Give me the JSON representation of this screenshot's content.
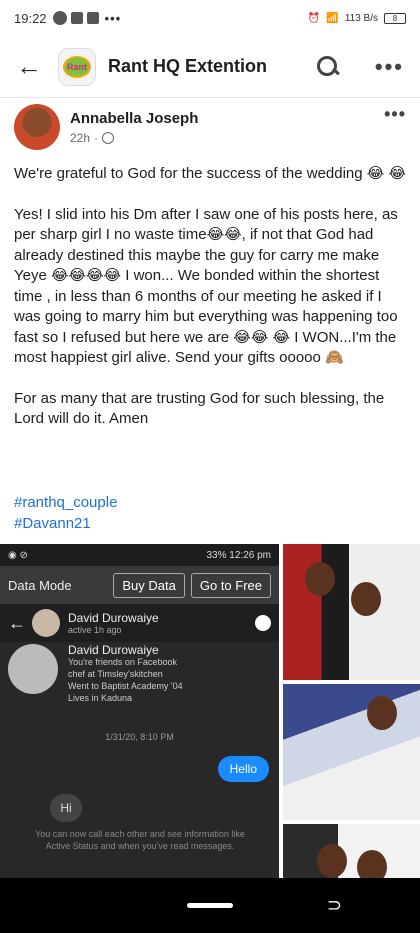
{
  "status": {
    "time": "19:22",
    "icons": [
      "whatsapp-icon",
      "twitter-icon",
      "gallery-icon"
    ],
    "right_text": "113 B/s"
  },
  "appbar": {
    "title": "Rant HQ Extention",
    "logo_text": "Rant"
  },
  "post": {
    "author": "Annabella Joseph",
    "time": "22h",
    "paragraphs": [
      "We're grateful to God for the success of the wedding 😂 😂",
      "Yes! I slid into his Dm after I saw one of his posts here, as per sharp girl I no waste time😂😂, if not that God had already destined this maybe the guy for carry me make Yeye 😂😂😂😂 I won... We bonded within the shortest time , in less than 6 months of our meeting he asked if I was going to marry him but everything was happening too fast so I refused but here we are 😂😂 😂 I WON...I'm the most happiest girl alive. Send your gifts ooooo 🙈",
      "For as many that are trusting God for such blessing, the Lord will do it. Amen"
    ],
    "hashtags": [
      "#ranthq_couple",
      "#Davann21"
    ]
  },
  "screenshot": {
    "status_right": "12:26 pm",
    "battery": "33%",
    "data_mode": "Data Mode",
    "buy_data": "Buy Data",
    "go_free": "Go to Free",
    "contact_name": "David Durowaiye",
    "contact_status": "active 1h ago",
    "profile_name": "David Durowaiye",
    "profile_lines": [
      "You're friends on Facebook",
      "chef at Timsley'skitchen",
      "Went to Baptist Academy '04",
      "Lives in Kaduna"
    ],
    "date": "1/31/20, 8:10 PM",
    "msg_out": "Hello",
    "msg_in": "Hi",
    "note": "You can now call each other and see information like Active Status and when you've read messages."
  }
}
